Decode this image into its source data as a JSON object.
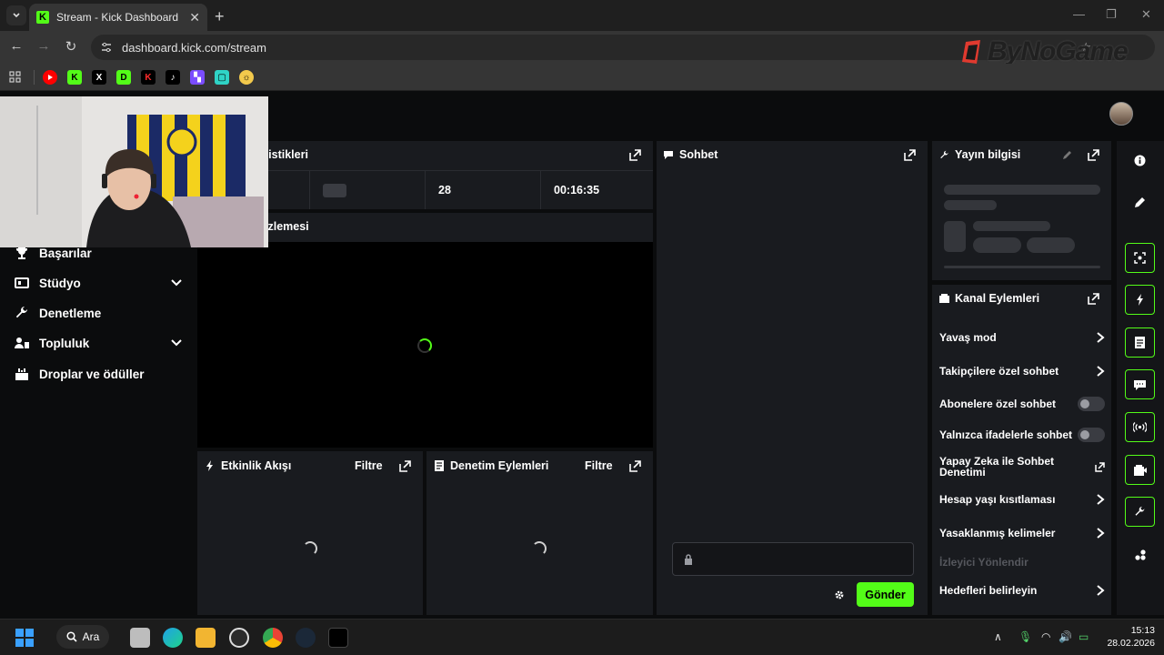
{
  "browser": {
    "tab_title": "Stream - Kick Dashboard",
    "tab_favicon": "K",
    "url": "dashboard.kick.com/stream",
    "watermark": "ByNoGame",
    "bookmarks": [
      "youtube-icon",
      "kick-icon",
      "x-icon",
      "d-icon",
      "kick-red-icon",
      "tiktok-icon",
      "twitch-icon",
      "chat-icon",
      "sun-icon"
    ]
  },
  "sidebar": {
    "items": [
      {
        "label": "Başarılar",
        "icon": "trophy-icon"
      },
      {
        "label": "Stüdyo",
        "icon": "studio-icon",
        "expandable": true
      },
      {
        "label": "Denetleme",
        "icon": "wrench-icon"
      },
      {
        "label": "Topluluk",
        "icon": "community-icon",
        "expandable": true
      },
      {
        "label": "Droplar ve ödüller",
        "icon": "gift-icon"
      }
    ]
  },
  "stats": {
    "title_fragment": "tistikleri",
    "followers": "28",
    "duration": "00:16:35"
  },
  "preview": {
    "title_fragment": "izlemesi"
  },
  "activity": {
    "title": "Etkinlik Akışı",
    "filter": "Filtre"
  },
  "mod_actions": {
    "title": "Denetim Eylemleri",
    "filter": "Filtre"
  },
  "chat": {
    "title": "Sohbet",
    "send": "Gönder"
  },
  "stream_info": {
    "title": "Yayın bilgisi"
  },
  "channel_actions": {
    "title": "Kanal Eylemleri",
    "rows": [
      {
        "label": "Yavaş mod",
        "control": "chevron"
      },
      {
        "label": "Takipçilere özel sohbet",
        "control": "chevron"
      },
      {
        "label": "Abonelere özel sohbet",
        "control": "toggle",
        "on": false
      },
      {
        "label": "Yalnızca ifadelerle sohbet",
        "control": "toggle",
        "on": false
      },
      {
        "label": "Yapay Zeka ile Sohbet Denetimi",
        "control": "external"
      },
      {
        "label": "Hesap yaşı kısıtlaması",
        "control": "chevron"
      },
      {
        "label": "Yasaklanmış kelimeler",
        "control": "chevron"
      },
      {
        "label": "İzleyici Yönlendir",
        "control": "disabled"
      },
      {
        "label": "Hedefleri belirleyin",
        "control": "chevron"
      }
    ]
  },
  "colors": {
    "accent": "#53fc18",
    "panel": "#191b1f",
    "bg": "#0b0c0d"
  },
  "taskbar": {
    "search_label": "Ara",
    "time": "15:13",
    "date": "28.02.2026"
  }
}
